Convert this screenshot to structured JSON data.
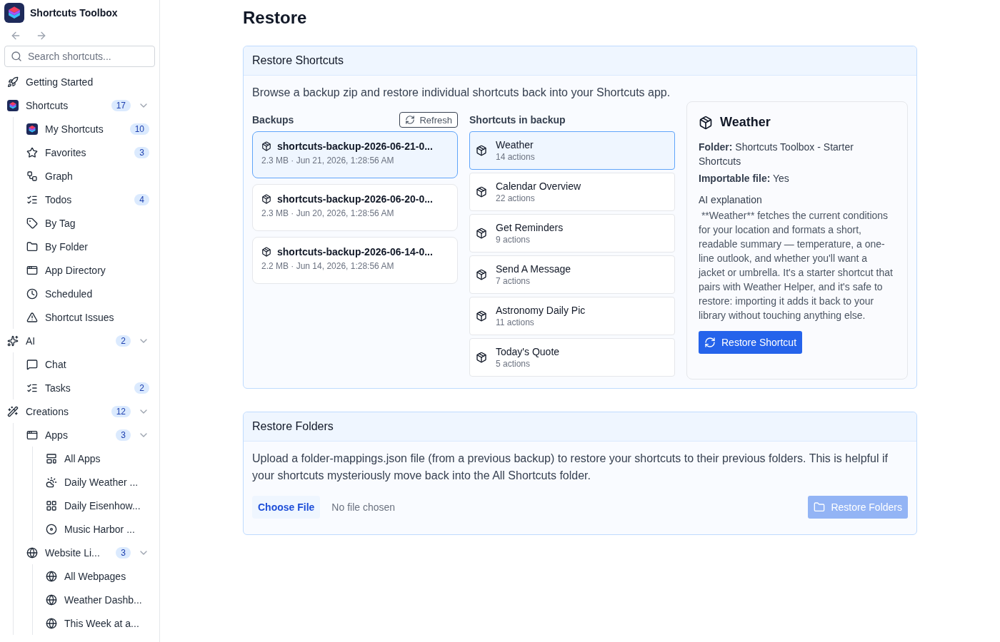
{
  "app": {
    "title": "Shortcuts Toolbox"
  },
  "search": {
    "placeholder": "Search shortcuts..."
  },
  "sidebar": {
    "items": [
      {
        "label": "Getting Started"
      },
      {
        "label": "Shortcuts",
        "count": "17",
        "expanded": true,
        "children": [
          {
            "label": "My Shortcuts",
            "count": "10"
          },
          {
            "label": "Favorites",
            "count": "3"
          },
          {
            "label": "Graph"
          },
          {
            "label": "Todos",
            "count": "4"
          },
          {
            "label": "By Tag"
          },
          {
            "label": "By Folder"
          },
          {
            "label": "App Directory"
          },
          {
            "label": "Scheduled"
          },
          {
            "label": "Shortcut Issues"
          }
        ]
      },
      {
        "label": "AI",
        "count": "2",
        "expanded": true,
        "children": [
          {
            "label": "Chat"
          },
          {
            "label": "Tasks",
            "count": "2"
          }
        ]
      },
      {
        "label": "Creations",
        "count": "12",
        "expanded": true,
        "children": [
          {
            "label": "Apps",
            "count": "3",
            "expanded": true,
            "children": [
              {
                "label": "All Apps"
              },
              {
                "label": "Daily Weather ..."
              },
              {
                "label": "Daily Eisenhow..."
              },
              {
                "label": "Music Harbor ..."
              }
            ]
          },
          {
            "label": "Website Li...",
            "count": "3",
            "expanded": true,
            "children": [
              {
                "label": "All Webpages"
              },
              {
                "label": "Weather Dashb..."
              },
              {
                "label": "This Week at a..."
              }
            ]
          }
        ]
      }
    ]
  },
  "page": {
    "title": "Restore"
  },
  "restore_shortcuts": {
    "title": "Restore Shortcuts",
    "description": "Browse a backup zip and restore individual shortcuts back into your Shortcuts app.",
    "backups_label": "Backups",
    "refresh_button": "Refresh",
    "shortcuts_label": "Shortcuts in backup",
    "backups": [
      {
        "name": "shortcuts-backup-2026-06-21-0...",
        "meta": "2.3 MB · Jun 21, 2026, 1:28:56 AM",
        "selected": true
      },
      {
        "name": "shortcuts-backup-2026-06-20-0...",
        "meta": "2.3 MB · Jun 20, 2026, 1:28:56 AM",
        "selected": false
      },
      {
        "name": "shortcuts-backup-2026-06-14-0...",
        "meta": "2.2 MB · Jun 14, 2026, 1:28:56 AM",
        "selected": false
      }
    ],
    "shortcuts": [
      {
        "name": "Weather",
        "actions": "14 actions",
        "selected": true
      },
      {
        "name": "Calendar Overview",
        "actions": "22 actions",
        "selected": false
      },
      {
        "name": "Get Reminders",
        "actions": "9 actions",
        "selected": false
      },
      {
        "name": "Send A Message",
        "actions": "7 actions",
        "selected": false
      },
      {
        "name": "Astronomy Daily Pic",
        "actions": "11 actions",
        "selected": false
      },
      {
        "name": "Today's Quote",
        "actions": "5 actions",
        "selected": false
      }
    ],
    "detail": {
      "title": "Weather",
      "fields": [
        {
          "label": "Folder:",
          "value": "Shortcuts Toolbox - Starter Shortcuts"
        },
        {
          "label": "Importable file:",
          "value": "Yes"
        }
      ],
      "explanation_label": "AI explanation",
      "explanation": " **Weather** fetches the current conditions for your location and formats a short, readable summary — temperature, a one-line outlook, and whether you'll want a jacket or umbrella. It's a starter shortcut that pairs with Weather Helper, and it's safe to restore: importing it adds it back to your library without touching anything else.",
      "restore_button": "Restore Shortcut"
    }
  },
  "restore_folders": {
    "title": "Restore Folders",
    "description": "Upload a folder-mappings.json file (from a previous backup) to restore your shortcuts to their previous folders. This is helpful if your shortcuts mysteriously move back into the All Shortcuts folder.",
    "choose_button": "Choose File",
    "file_status": "No file chosen",
    "restore_button": {
      "label": "Restore Folders",
      "disabled": true
    }
  }
}
